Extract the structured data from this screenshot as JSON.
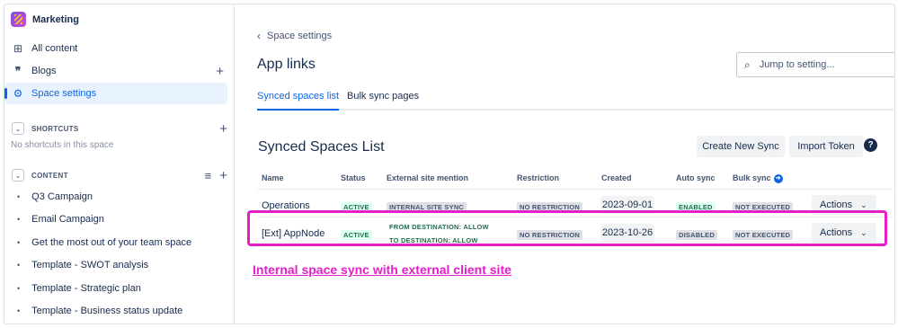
{
  "sidebar": {
    "space_name": "Marketing",
    "nav": [
      {
        "label": "All content",
        "icon": "grid-icon"
      },
      {
        "label": "Blogs",
        "icon": "quote-icon"
      },
      {
        "label": "Space settings",
        "icon": "gear-icon",
        "active": true
      }
    ],
    "shortcuts": {
      "label": "SHORTCUTS",
      "empty": "No shortcuts in this space"
    },
    "content": {
      "label": "CONTENT",
      "items": [
        "Q3 Campaign",
        "Email Campaign",
        "Get the most out of your team space",
        "Template - SWOT analysis",
        "Template - Strategic plan",
        "Template - Business status update"
      ]
    }
  },
  "main": {
    "back_label": "Space settings",
    "title": "App links",
    "search_placeholder": "Jump to setting...",
    "tabs": [
      "Synced spaces list",
      "Bulk sync pages"
    ],
    "list_title": "Synced Spaces List",
    "create_button": "Create New Sync",
    "import_button": "Import Token",
    "columns": [
      "Name",
      "Status",
      "External site mention",
      "Restriction",
      "Created",
      "Auto sync",
      "Bulk sync"
    ],
    "rows": [
      {
        "name": "Operations",
        "status": "ACTIVE",
        "mention": "INTERNAL SITE SYNC",
        "restriction": "NO RESTRICTION",
        "created": "2023-09-01",
        "auto_sync": "ENABLED",
        "bulk_sync": "NOT EXECUTED",
        "actions": "Actions"
      },
      {
        "name": "[Ext] AppNode",
        "status": "ACTIVE",
        "mention_1": "FROM DESTINATION: ALLOW",
        "mention_2": "TO DESTINATION: ALLOW",
        "restriction": "NO RESTRICTION",
        "created": "2023-10-26",
        "auto_sync": "DISABLED",
        "bulk_sync": "NOT EXECUTED",
        "actions": "Actions"
      }
    ],
    "caption": "Internal space sync with external client site"
  },
  "colors": {
    "accent": "#0c66e4",
    "highlight": "#e61ec8",
    "active_green": "#216e4e"
  }
}
